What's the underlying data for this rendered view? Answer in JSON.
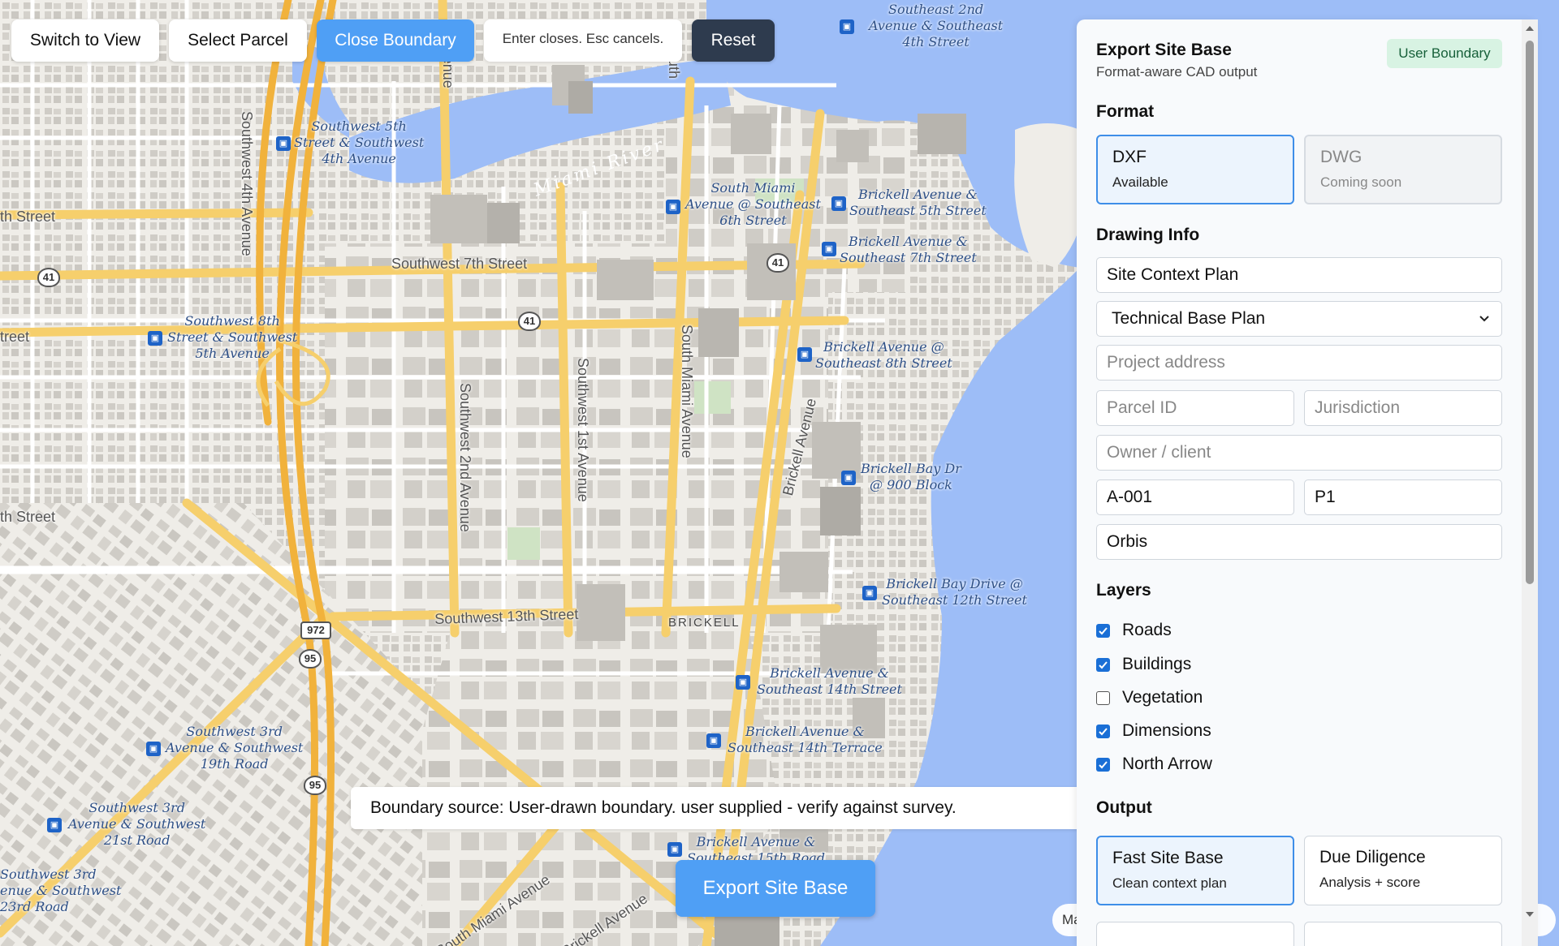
{
  "toolbar": {
    "switch_view": "Switch to View",
    "select_parcel": "Select Parcel",
    "close_boundary": "Close Boundary",
    "hint": "Enter closes. Esc cancels.",
    "reset": "Reset"
  },
  "map": {
    "water_label": "Miami River",
    "streets": [
      "Southwest 7th Street",
      "Southwest 13th Street",
      "Southwest 4th Avenue",
      "Southwest 2nd Avenue",
      "Southwest 1st Avenue",
      "South Miami Avenue",
      "Brickell Avenue",
      "South Miami Avenue",
      "Brickell Avenue",
      "th Street",
      "treet",
      "th Street",
      "Avenue",
      "South"
    ],
    "neighborhood": "BRICKELL",
    "stops": [
      "Southeast 2nd\nAvenue & Southeast\n4th Street",
      "Southwest 5th\nStreet & Southwest\n4th Avenue",
      "South Miami\nAvenue @ Southeast\n6th Street",
      "Brickell Avenue &\nSoutheast 5th Street",
      "Brickell Avenue &\nSoutheast 7th Street",
      "Southwest 8th\nStreet & Southwest\n5th Avenue",
      "Brickell Avenue @\nSoutheast 8th Street",
      "Brickell Bay Dr\n@ 900 Block",
      "Brickell Bay Drive @\nSoutheast 12th Street",
      "Brickell Avenue &\nSoutheast 14th Street",
      "Brickell Avenue &\nSoutheast 14th Terrace",
      "Southwest 3rd\nAvenue & Southwest\n19th Road",
      "Southwest 3rd\nAvenue & Southwest\n21st Road",
      "Southwest 3rd\nenue & Southwest\n23rd Road",
      "Brickell Avenue &\nSoutheast 15th Road"
    ],
    "shields": [
      "41",
      "41",
      "41",
      "972",
      "95",
      "95"
    ]
  },
  "status": {
    "boundary_text": "Boundary source: User-drawn boundary. user supplied - verify against survey."
  },
  "export_button": "Export Site Base",
  "attribution": "Ma",
  "panel": {
    "title": "Export Site Base",
    "subtitle": "Format-aware CAD output",
    "badge": "User Boundary",
    "format_heading": "Format",
    "formats": [
      {
        "name": "DXF",
        "status": "Available"
      },
      {
        "name": "DWG",
        "status": "Coming soon"
      }
    ],
    "drawing_heading": "Drawing Info",
    "drawing_title": "Site Context Plan",
    "plan_type": "Technical Base Plan",
    "project_address_ph": "Project address",
    "parcel_id_ph": "Parcel ID",
    "jurisdiction_ph": "Jurisdiction",
    "owner_ph": "Owner / client",
    "sheet_number": "A-001",
    "revision": "P1",
    "author": "Orbis",
    "layers_heading": "Layers",
    "layers": [
      {
        "name": "Roads",
        "checked": true
      },
      {
        "name": "Buildings",
        "checked": true
      },
      {
        "name": "Vegetation",
        "checked": false
      },
      {
        "name": "Dimensions",
        "checked": true
      },
      {
        "name": "North Arrow",
        "checked": true
      }
    ],
    "output_heading": "Output",
    "outputs": [
      {
        "name": "Fast Site Base",
        "desc": "Clean context plan"
      },
      {
        "name": "Due Diligence",
        "desc": "Analysis + score"
      }
    ]
  },
  "colors": {
    "accent": "#4f9ff5",
    "water": "#9dbdf7",
    "road_major": "#f6cf6c",
    "badge_bg": "#d8f3e3"
  }
}
